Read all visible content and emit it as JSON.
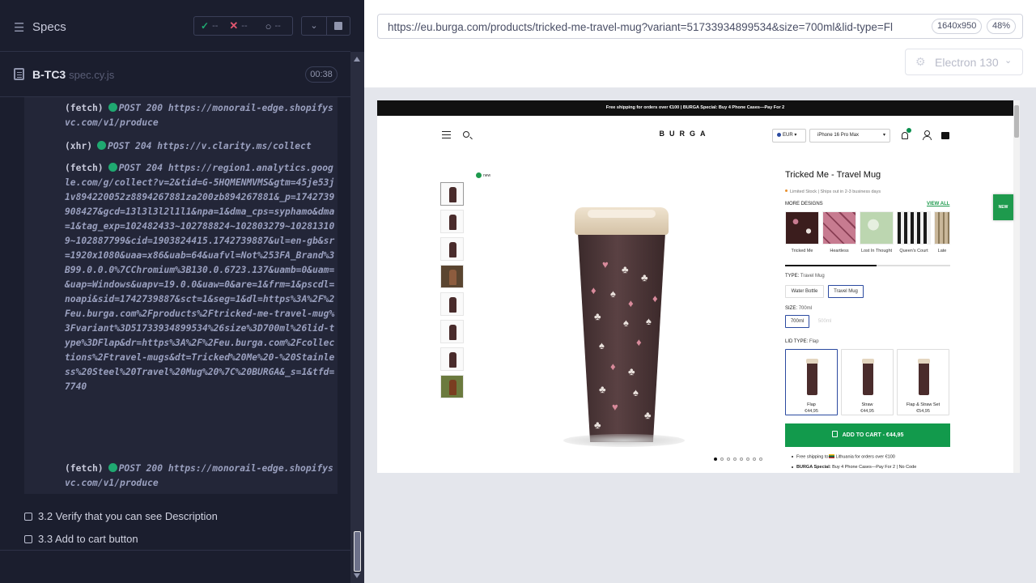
{
  "runner": {
    "menu_icon": "hamburger-icon",
    "title": "Specs",
    "stats": {
      "passed": "--",
      "failed": "--",
      "pending": "--"
    },
    "spec_name": "B-TC3",
    "spec_ext": "spec.cy.js",
    "timer": "00:38",
    "log": [
      {
        "kind": "(fetch)",
        "text": "POST 200 https://monorail-edge.shopifysvc.com/v1/produce"
      },
      {
        "kind": "(xhr)",
        "text": "POST 204 https://v.clarity.ms/collect"
      },
      {
        "kind": "(fetch)",
        "text": "POST 204 https://region1.analytics.google.com/g/collect?v=2&tid=G-5HQMENMVMS&gtm=45je53j1v894220052z8894267881za200zb894267881&_p=1742739908427&gcd=13l3l3l2l1l1&npa=1&dma_cps=syphamo&dma=1&tag_exp=102482433~102788824~102803279~102813109~102887799&cid=1903824415.1742739887&ul=en-gb&sr=1920x1080&uaa=x86&uab=64&uafvl=Not%253FA_Brand%3B99.0.0.0%7CChromium%3B130.0.6723.137&uamb=0&uam=&uap=Windows&uapv=19.0.0&uaw=0&are=1&frm=1&pscdl=noapi&sid=1742739887&sct=1&seg=1&dl=https%3A%2F%2Feu.burga.com%2Fproducts%2Ftricked-me-travel-mug%3Fvariant%3D51733934899534%26size%3D700ml%26lid-type%3DFlap&dr=https%3A%2F%2Feu.burga.com%2Fcollections%2Ftravel-mugs&dt=Tricked%20Me%20-%20Stainless%20Steel%20Travel%20Mug%20%7C%20BURGA&_s=1&tfd=7740"
      },
      {
        "kind": "(fetch)",
        "text": "POST 200 https://monorail-edge.shopifysvc.com/v1/produce"
      }
    ],
    "steps": [
      {
        "label": "3.2 Verify that you can see Description"
      },
      {
        "label": "3.3 Add to cart button"
      }
    ]
  },
  "aut": {
    "url": "https://eu.burga.com/products/tricked-me-travel-mug?variant=51733934899534&size=700ml&lid-type=Fl",
    "viewport": "1640x950",
    "zoom": "48%",
    "browser": "Electron 130"
  },
  "page": {
    "promo": "Free shipping for orders over €100   |   BURGA Special: Buy 4 Phone Cases—Pay For 2",
    "logo": "BURGA",
    "currency": "EUR",
    "phone_model": "iPhone 16 Pro Max",
    "new_badge": "new",
    "product_title": "Tricked Me - Travel Mug",
    "stock": "Limited Stock | Ships out in 2-3 business days",
    "more_designs": "MORE DESIGNS",
    "view_all": "VIEW ALL",
    "designs": [
      {
        "name": "Tricked Me",
        "color": "#3b1d1d"
      },
      {
        "name": "Heartless",
        "color": "#c77b90"
      },
      {
        "name": "Lost In Thought",
        "color": "#bcd6b0"
      },
      {
        "name": "Queen's Court",
        "color": "#1a1a1a"
      },
      {
        "name": "Late",
        "color": "#c9b79a"
      }
    ],
    "type_label": "TYPE:",
    "type_value": "Travel Mug",
    "type_options": [
      "Water Bottle",
      "Travel Mug"
    ],
    "size_label": "SIZE:",
    "size_value": "700ml",
    "size_options": [
      "700ml",
      "500ml"
    ],
    "lid_label": "LID TYPE:",
    "lid_value": "Flap",
    "lids": [
      {
        "name": "Flap",
        "price": "€44,95"
      },
      {
        "name": "Straw",
        "price": "€44,95"
      },
      {
        "name": "Flap & Straw Set",
        "price": "€54,95"
      }
    ],
    "add_to_cart": "ADD TO CART  -  €44,95",
    "bullet1_pre": "Free shipping to",
    "bullet1_post": "Lithuania for orders over €100",
    "bullet2_bold": "BURGA Special:",
    "bullet2_rest": "Buy 4 Phone Cases—Pay For 2 | No Code",
    "side_tab": "NEW"
  },
  "colors": {
    "accent_green": "#129a4c",
    "cypress_bg": "#1b1e2e",
    "pass": "#1fa971",
    "fail": "#e45770"
  }
}
